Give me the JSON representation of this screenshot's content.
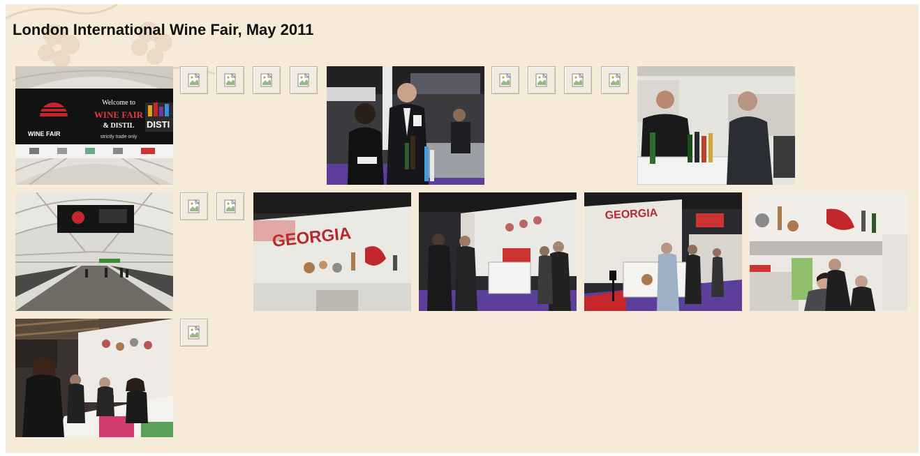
{
  "page": {
    "title": "London International Wine Fair, May 2011"
  },
  "banner_photo": {
    "welcome_line": "Welcome to",
    "event_line1": "WINE FAIR",
    "event_line2": "& DISTIL",
    "trade_line": "strictly trade only",
    "logo_text": "WINE FAIR",
    "distil_text": "DISTI"
  },
  "booth_sign": {
    "georgia_text": "GEORGIA"
  },
  "gallery": {
    "rows": [
      [
        "photo-banner",
        "broken",
        "broken",
        "broken",
        "broken",
        "photo-couple",
        "broken",
        "broken",
        "broken",
        "broken",
        "photo-bartender"
      ],
      [
        "photo-walkway",
        "broken",
        "broken",
        "photo-georgia-wall",
        "photo-booth-crowd",
        "photo-booth-counter",
        "photo-hostess"
      ],
      [
        "photo-tasting",
        "broken"
      ]
    ]
  },
  "colors": {
    "page_background": "#f6ead9",
    "banner_black": "#111111",
    "brand_red": "#c1272d",
    "carpet_purple": "#5b3f9a"
  }
}
